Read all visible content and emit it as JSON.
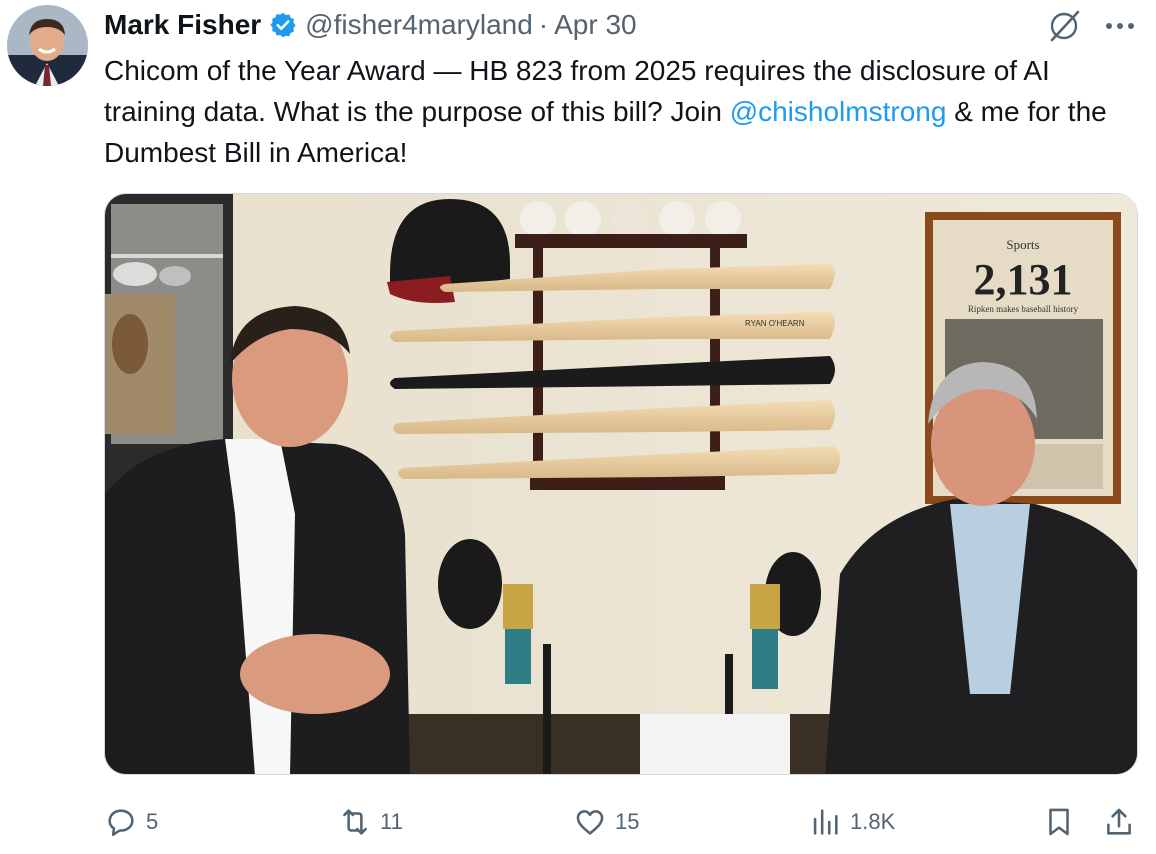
{
  "author": {
    "name": "Mark Fisher",
    "handle": "@fisher4maryland",
    "separator": "·",
    "date": "Apr 30",
    "verified_color": "#1d9bf0"
  },
  "tweet": {
    "text_part1": "Chicom of the Year Award — HB 823 from 2025 requires the disclosure of AI training data. What is the purpose of this bill? Join ",
    "mention": "@chisholmstrong",
    "text_part2": " & me for the Dumbest Bill in America!"
  },
  "media": {
    "newspaper_section": "Sports",
    "newspaper_headline": "2,131",
    "newspaper_subhead": "Ripken makes baseball history",
    "bat_labels": [
      "RYAN O'HEARN"
    ]
  },
  "actions": {
    "reply_count": "5",
    "retweet_count": "11",
    "like_count": "15",
    "views_count": "1.8K"
  },
  "colors": {
    "text_primary": "#0f1419",
    "text_secondary": "#536471",
    "link": "#1d9bf0"
  },
  "icons": [
    "grok-icon",
    "more-icon",
    "reply-icon",
    "retweet-icon",
    "like-icon",
    "views-icon",
    "bookmark-icon",
    "share-icon"
  ]
}
